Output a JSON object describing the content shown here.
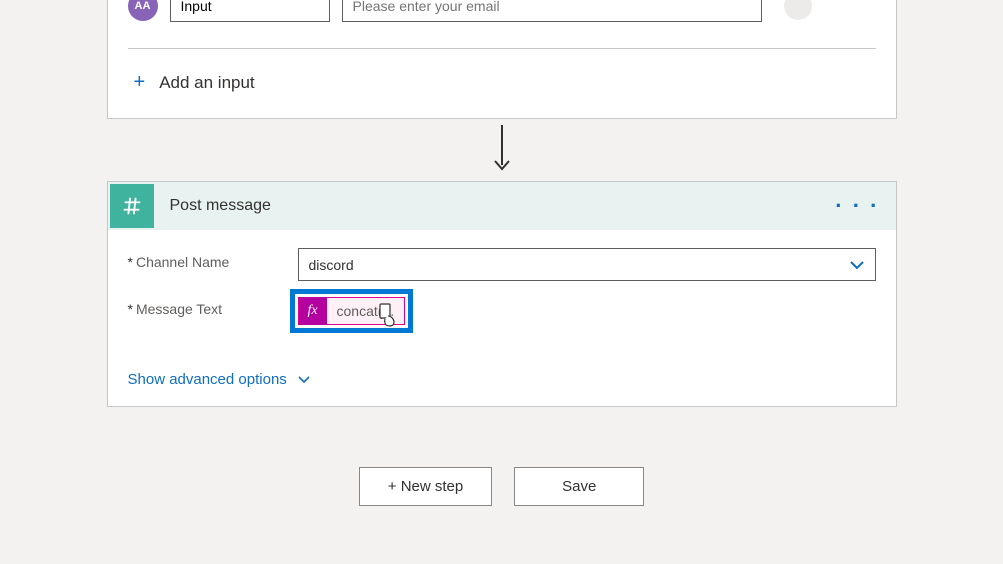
{
  "trigger": {
    "avatar_initials": "AA",
    "input_name": "Input",
    "input_placeholder": "Please enter your email",
    "add_input_label": "Add an input"
  },
  "action": {
    "title": "Post message",
    "fields": {
      "channel_label": "Channel Name",
      "channel_value": "discord",
      "message_label": "Message Text",
      "message_token": "concat(...",
      "fx_label": "fx"
    },
    "advanced_label": "Show advanced options"
  },
  "buttons": {
    "new_step": "+ New step",
    "save": "Save"
  }
}
